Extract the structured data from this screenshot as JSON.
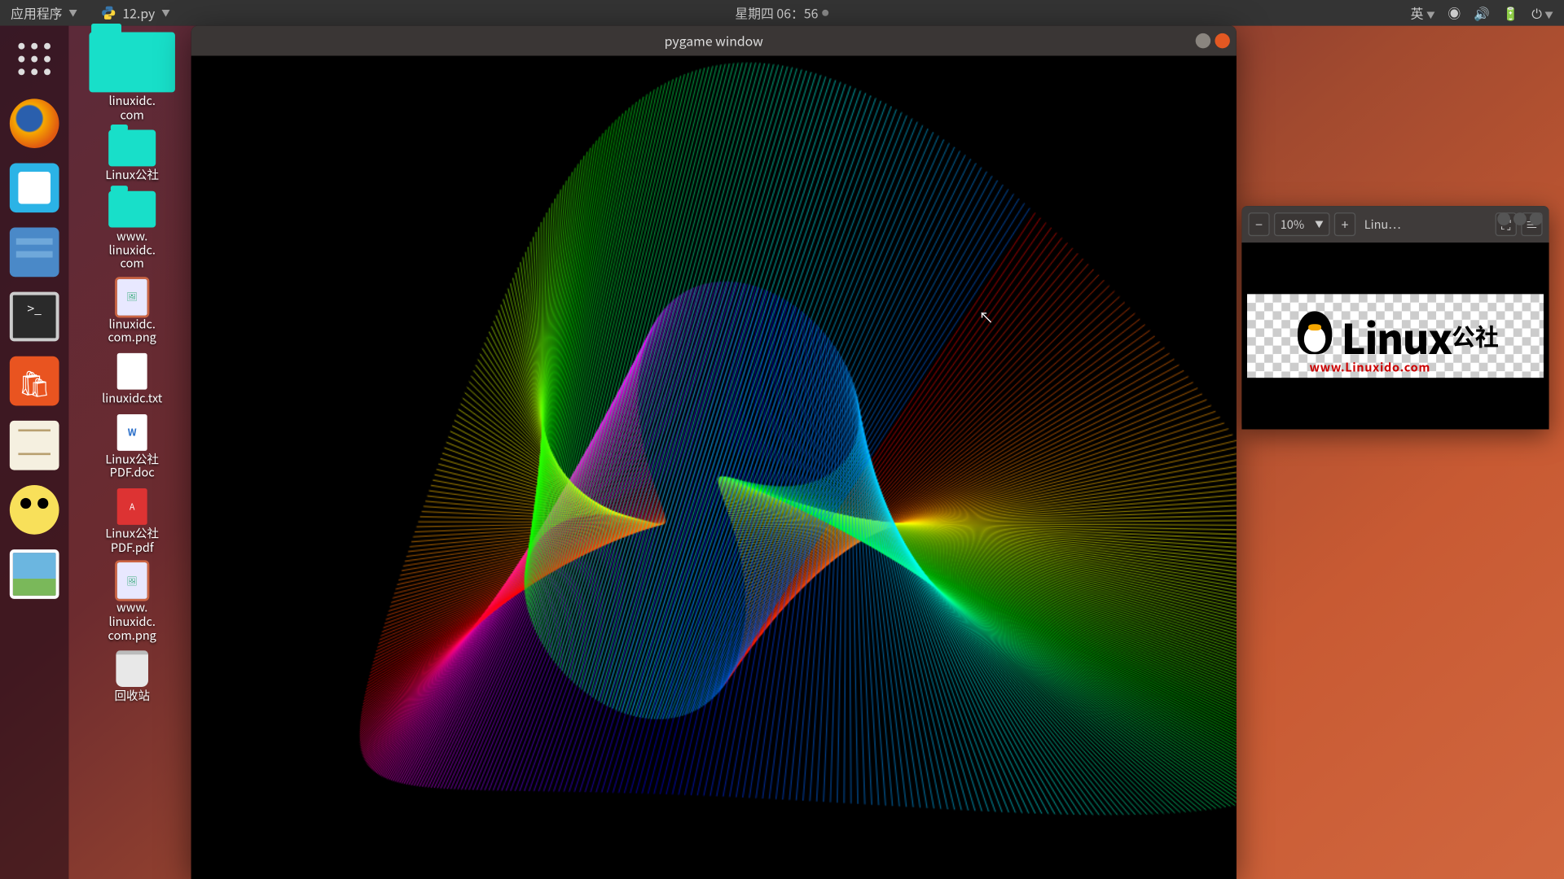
{
  "panel": {
    "apps_label": "应用程序",
    "active_app": "12.py",
    "clock": "星期四 06：56",
    "ime": "英"
  },
  "desktop_icons": [
    {
      "type": "folder-big",
      "label": "linuxidc.\ncom"
    },
    {
      "type": "folder",
      "label": "Linux公社"
    },
    {
      "type": "folder",
      "label": "www.\nlinuxidc.\ncom"
    },
    {
      "type": "thumb-sel",
      "label": "linuxidc.\ncom.png"
    },
    {
      "type": "thumb",
      "label": "linuxidc.txt"
    },
    {
      "type": "thumb-doc",
      "label": "Linux公社\nPDF.doc"
    },
    {
      "type": "thumb-pdf",
      "label": "Linux公社\nPDF.pdf"
    },
    {
      "type": "thumb-sel",
      "label": "www.\nlinuxidc.\ncom.png"
    },
    {
      "type": "trash",
      "label": "回收站"
    }
  ],
  "pygame": {
    "title": "pygame window"
  },
  "viewer": {
    "zoom": "10%",
    "title": "Linu…",
    "logo_main": "Linux",
    "logo_cjk": "公社",
    "logo_sub": "www.Linuxido.com"
  }
}
